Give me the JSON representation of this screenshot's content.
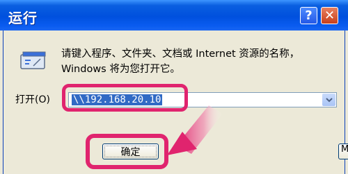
{
  "window": {
    "title": "运行",
    "help_label": "?",
    "close_label": "✕"
  },
  "dialog": {
    "description": "请键入程序、文件夹、文档或 Internet 资源的名称，Windows 将为您打开它。",
    "open_label": "打开(O)",
    "address_value": "\\\\192.168.20.10",
    "ok_label": "确定",
    "partial_button_label": "M"
  },
  "icons": {
    "run": "run-icon",
    "dropdown": "chevron-down-icon"
  },
  "colors": {
    "titlebar": "#0050de",
    "highlight": "#e0246e",
    "selection": "#316ac5"
  }
}
